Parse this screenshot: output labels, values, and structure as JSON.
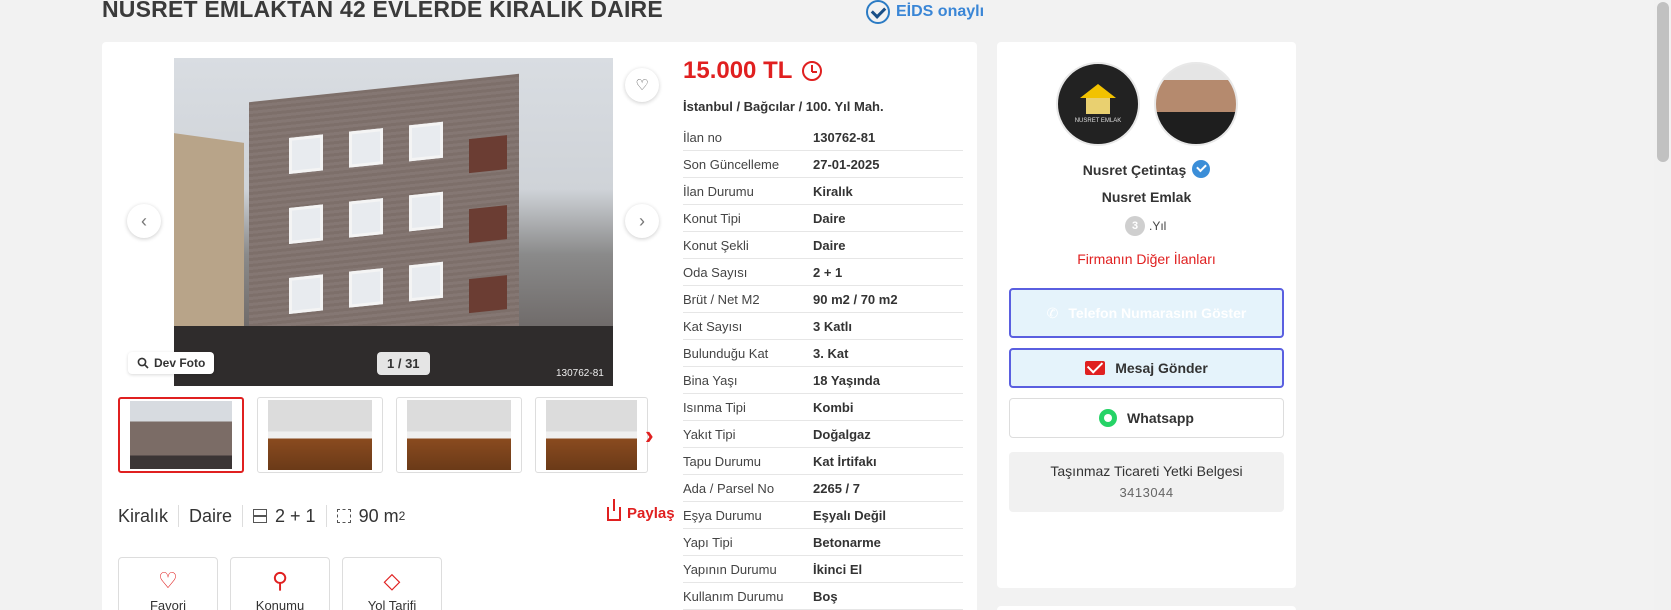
{
  "header": {
    "title": "NUSRET EMLAKTAN 42 EVLERDE KİRALIK DAİRE",
    "eids_label": "EİDS onaylı"
  },
  "gallery": {
    "counter": "1 / 31",
    "dev_foto_label": "Dev Foto",
    "watermark_id": "130762-81",
    "thumbnails": [
      "building",
      "room",
      "room",
      "room"
    ]
  },
  "summary": {
    "status": "Kiralık",
    "type": "Daire",
    "rooms": "2 + 1",
    "area": "90 m",
    "area_sup": "2",
    "share_label": "Paylaş"
  },
  "actions": [
    {
      "label": "Favori",
      "icon": "heart-icon"
    },
    {
      "label": "Konumu",
      "icon": "map-pin-icon"
    },
    {
      "label": "Yol Tarifi",
      "icon": "directions-icon"
    }
  ],
  "listing": {
    "price": "15.000 TL",
    "location": "İstanbul / Bağcılar / 100. Yıl Mah.",
    "details": [
      {
        "key": "İlan no",
        "value": "130762-81"
      },
      {
        "key": "Son Güncelleme",
        "value": "27-01-2025"
      },
      {
        "key": "İlan Durumu",
        "value": "Kiralık"
      },
      {
        "key": "Konut Tipi",
        "value": "Daire"
      },
      {
        "key": "Konut Şekli",
        "value": "Daire"
      },
      {
        "key": "Oda Sayısı",
        "value": "2 + 1"
      },
      {
        "key": "Brüt / Net M2",
        "value": "90 m2 / 70 m2"
      },
      {
        "key": "Kat Sayısı",
        "value": "3 Katlı"
      },
      {
        "key": "Bulunduğu Kat",
        "value": "3. Kat"
      },
      {
        "key": "Bina Yaşı",
        "value": "18 Yaşında"
      },
      {
        "key": "Isınma Tipi",
        "value": "Kombi"
      },
      {
        "key": "Yakıt Tipi",
        "value": "Doğalgaz"
      },
      {
        "key": "Tapu Durumu",
        "value": "Kat İrtifakı"
      },
      {
        "key": "Ada / Parsel No",
        "value": "2265 / 7"
      },
      {
        "key": "Eşya Durumu",
        "value": "Eşyalı Değil"
      },
      {
        "key": "Yapı Tipi",
        "value": "Betonarme"
      },
      {
        "key": "Yapının Durumu",
        "value": "İkinci El"
      },
      {
        "key": "Kullanım Durumu",
        "value": "Boş"
      }
    ]
  },
  "agent": {
    "logo_text": "NUSRET EMLAK",
    "name": "Nusret Çetintaş",
    "firm": "Nusret Emlak",
    "years": "3",
    "years_suffix": ".Yıl",
    "other_listings": "Firmanın Diğer İlanları",
    "phone_button": "Telefon Numarasını Göster",
    "message_button": "Mesaj Gönder",
    "whatsapp_button": "Whatsapp",
    "cert_title": "Taşınmaz Ticareti Yetki Belgesi",
    "cert_no": "3413044"
  },
  "colors": {
    "accent": "#e02020",
    "button_border": "#5a5fe0",
    "verified": "#3b8ed8",
    "whatsapp": "#25d366"
  }
}
